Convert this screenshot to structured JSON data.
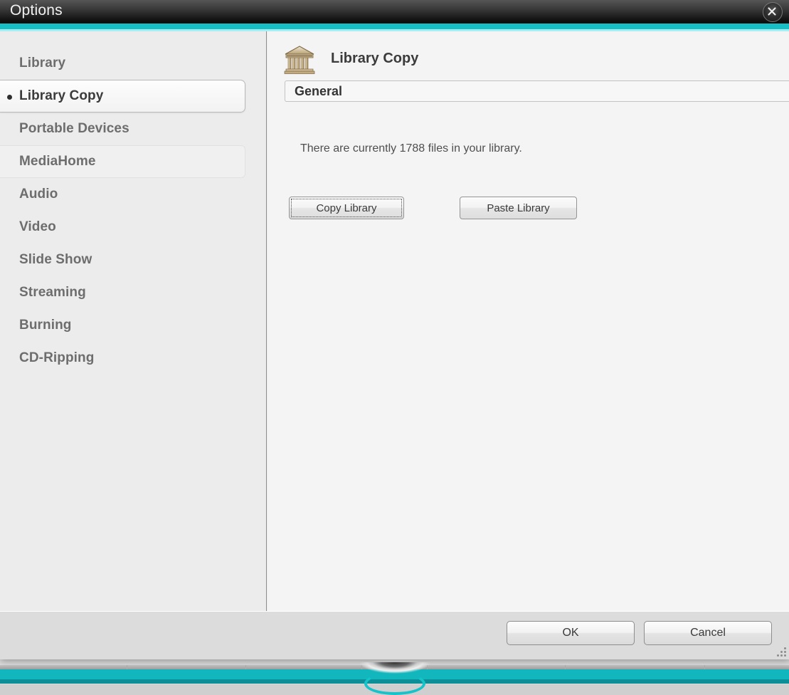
{
  "window": {
    "title": "Options",
    "close_icon": "close-circle-x-icon"
  },
  "sidebar": {
    "items": [
      {
        "label": "Library",
        "state": "normal"
      },
      {
        "label": "Library Copy",
        "state": "selected"
      },
      {
        "label": "Portable Devices",
        "state": "normal"
      },
      {
        "label": "MediaHome",
        "state": "hovered"
      },
      {
        "label": "Audio",
        "state": "normal"
      },
      {
        "label": "Video",
        "state": "normal"
      },
      {
        "label": "Slide Show",
        "state": "normal"
      },
      {
        "label": "Streaming",
        "state": "normal"
      },
      {
        "label": "Burning",
        "state": "normal"
      },
      {
        "label": "CD-Ripping",
        "state": "normal"
      }
    ]
  },
  "content": {
    "icon": "library-building-icon",
    "title": "Library Copy",
    "group_label": "General",
    "status_text": "There are currently 1788 files in your library.",
    "file_count": 1788,
    "copy_button": "Copy Library",
    "paste_button": "Paste Library"
  },
  "footer": {
    "ok_button": "OK",
    "cancel_button": "Cancel",
    "resize_grip_icon": "resize-grip-icon"
  },
  "colors": {
    "accent_teal": "#17bfc4",
    "accent_teal_light": "#a6eef1",
    "titlebar_dark": "#161616",
    "dialog_background": "#ededed",
    "content_background": "#f4f4f4",
    "footer_background": "#dcdcdc"
  }
}
